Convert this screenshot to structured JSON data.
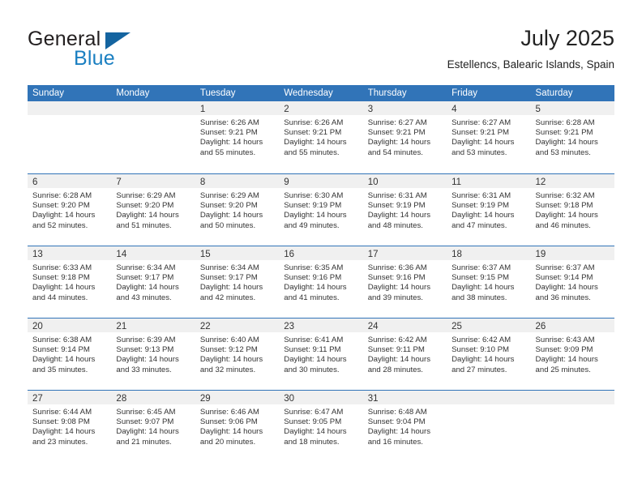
{
  "brand": {
    "name_part1": "General",
    "name_part2": "Blue",
    "triangle_icon": "triangle-icon",
    "colors": {
      "dark": "#231f20",
      "blue": "#1a7fc1",
      "triangle": "#1464a0"
    }
  },
  "header": {
    "title": "July 2025",
    "subtitle": "Estellencs, Balearic Islands, Spain"
  },
  "theme": {
    "header_blue": "#3174b8",
    "daynum_band": "#f0f0f0",
    "text": "#333333",
    "background": "#ffffff"
  },
  "weekdays": [
    "Sunday",
    "Monday",
    "Tuesday",
    "Wednesday",
    "Thursday",
    "Friday",
    "Saturday"
  ],
  "labels": {
    "sunrise": "Sunrise:",
    "sunset": "Sunset:",
    "daylight": "Daylight:"
  },
  "weeks": [
    [
      {
        "day": "",
        "sunrise": "",
        "sunset": "",
        "daylight_line1": "",
        "daylight_line2": "",
        "empty": true
      },
      {
        "day": "",
        "sunrise": "",
        "sunset": "",
        "daylight_line1": "",
        "daylight_line2": "",
        "empty": true
      },
      {
        "day": "1",
        "sunrise": "Sunrise: 6:26 AM",
        "sunset": "Sunset: 9:21 PM",
        "daylight_line1": "Daylight: 14 hours",
        "daylight_line2": "and 55 minutes.",
        "empty": false
      },
      {
        "day": "2",
        "sunrise": "Sunrise: 6:26 AM",
        "sunset": "Sunset: 9:21 PM",
        "daylight_line1": "Daylight: 14 hours",
        "daylight_line2": "and 55 minutes.",
        "empty": false
      },
      {
        "day": "3",
        "sunrise": "Sunrise: 6:27 AM",
        "sunset": "Sunset: 9:21 PM",
        "daylight_line1": "Daylight: 14 hours",
        "daylight_line2": "and 54 minutes.",
        "empty": false
      },
      {
        "day": "4",
        "sunrise": "Sunrise: 6:27 AM",
        "sunset": "Sunset: 9:21 PM",
        "daylight_line1": "Daylight: 14 hours",
        "daylight_line2": "and 53 minutes.",
        "empty": false
      },
      {
        "day": "5",
        "sunrise": "Sunrise: 6:28 AM",
        "sunset": "Sunset: 9:21 PM",
        "daylight_line1": "Daylight: 14 hours",
        "daylight_line2": "and 53 minutes.",
        "empty": false
      }
    ],
    [
      {
        "day": "6",
        "sunrise": "Sunrise: 6:28 AM",
        "sunset": "Sunset: 9:20 PM",
        "daylight_line1": "Daylight: 14 hours",
        "daylight_line2": "and 52 minutes.",
        "empty": false
      },
      {
        "day": "7",
        "sunrise": "Sunrise: 6:29 AM",
        "sunset": "Sunset: 9:20 PM",
        "daylight_line1": "Daylight: 14 hours",
        "daylight_line2": "and 51 minutes.",
        "empty": false
      },
      {
        "day": "8",
        "sunrise": "Sunrise: 6:29 AM",
        "sunset": "Sunset: 9:20 PM",
        "daylight_line1": "Daylight: 14 hours",
        "daylight_line2": "and 50 minutes.",
        "empty": false
      },
      {
        "day": "9",
        "sunrise": "Sunrise: 6:30 AM",
        "sunset": "Sunset: 9:19 PM",
        "daylight_line1": "Daylight: 14 hours",
        "daylight_line2": "and 49 minutes.",
        "empty": false
      },
      {
        "day": "10",
        "sunrise": "Sunrise: 6:31 AM",
        "sunset": "Sunset: 9:19 PM",
        "daylight_line1": "Daylight: 14 hours",
        "daylight_line2": "and 48 minutes.",
        "empty": false
      },
      {
        "day": "11",
        "sunrise": "Sunrise: 6:31 AM",
        "sunset": "Sunset: 9:19 PM",
        "daylight_line1": "Daylight: 14 hours",
        "daylight_line2": "and 47 minutes.",
        "empty": false
      },
      {
        "day": "12",
        "sunrise": "Sunrise: 6:32 AM",
        "sunset": "Sunset: 9:18 PM",
        "daylight_line1": "Daylight: 14 hours",
        "daylight_line2": "and 46 minutes.",
        "empty": false
      }
    ],
    [
      {
        "day": "13",
        "sunrise": "Sunrise: 6:33 AM",
        "sunset": "Sunset: 9:18 PM",
        "daylight_line1": "Daylight: 14 hours",
        "daylight_line2": "and 44 minutes.",
        "empty": false
      },
      {
        "day": "14",
        "sunrise": "Sunrise: 6:34 AM",
        "sunset": "Sunset: 9:17 PM",
        "daylight_line1": "Daylight: 14 hours",
        "daylight_line2": "and 43 minutes.",
        "empty": false
      },
      {
        "day": "15",
        "sunrise": "Sunrise: 6:34 AM",
        "sunset": "Sunset: 9:17 PM",
        "daylight_line1": "Daylight: 14 hours",
        "daylight_line2": "and 42 minutes.",
        "empty": false
      },
      {
        "day": "16",
        "sunrise": "Sunrise: 6:35 AM",
        "sunset": "Sunset: 9:16 PM",
        "daylight_line1": "Daylight: 14 hours",
        "daylight_line2": "and 41 minutes.",
        "empty": false
      },
      {
        "day": "17",
        "sunrise": "Sunrise: 6:36 AM",
        "sunset": "Sunset: 9:16 PM",
        "daylight_line1": "Daylight: 14 hours",
        "daylight_line2": "and 39 minutes.",
        "empty": false
      },
      {
        "day": "18",
        "sunrise": "Sunrise: 6:37 AM",
        "sunset": "Sunset: 9:15 PM",
        "daylight_line1": "Daylight: 14 hours",
        "daylight_line2": "and 38 minutes.",
        "empty": false
      },
      {
        "day": "19",
        "sunrise": "Sunrise: 6:37 AM",
        "sunset": "Sunset: 9:14 PM",
        "daylight_line1": "Daylight: 14 hours",
        "daylight_line2": "and 36 minutes.",
        "empty": false
      }
    ],
    [
      {
        "day": "20",
        "sunrise": "Sunrise: 6:38 AM",
        "sunset": "Sunset: 9:14 PM",
        "daylight_line1": "Daylight: 14 hours",
        "daylight_line2": "and 35 minutes.",
        "empty": false
      },
      {
        "day": "21",
        "sunrise": "Sunrise: 6:39 AM",
        "sunset": "Sunset: 9:13 PM",
        "daylight_line1": "Daylight: 14 hours",
        "daylight_line2": "and 33 minutes.",
        "empty": false
      },
      {
        "day": "22",
        "sunrise": "Sunrise: 6:40 AM",
        "sunset": "Sunset: 9:12 PM",
        "daylight_line1": "Daylight: 14 hours",
        "daylight_line2": "and 32 minutes.",
        "empty": false
      },
      {
        "day": "23",
        "sunrise": "Sunrise: 6:41 AM",
        "sunset": "Sunset: 9:11 PM",
        "daylight_line1": "Daylight: 14 hours",
        "daylight_line2": "and 30 minutes.",
        "empty": false
      },
      {
        "day": "24",
        "sunrise": "Sunrise: 6:42 AM",
        "sunset": "Sunset: 9:11 PM",
        "daylight_line1": "Daylight: 14 hours",
        "daylight_line2": "and 28 minutes.",
        "empty": false
      },
      {
        "day": "25",
        "sunrise": "Sunrise: 6:42 AM",
        "sunset": "Sunset: 9:10 PM",
        "daylight_line1": "Daylight: 14 hours",
        "daylight_line2": "and 27 minutes.",
        "empty": false
      },
      {
        "day": "26",
        "sunrise": "Sunrise: 6:43 AM",
        "sunset": "Sunset: 9:09 PM",
        "daylight_line1": "Daylight: 14 hours",
        "daylight_line2": "and 25 minutes.",
        "empty": false
      }
    ],
    [
      {
        "day": "27",
        "sunrise": "Sunrise: 6:44 AM",
        "sunset": "Sunset: 9:08 PM",
        "daylight_line1": "Daylight: 14 hours",
        "daylight_line2": "and 23 minutes.",
        "empty": false
      },
      {
        "day": "28",
        "sunrise": "Sunrise: 6:45 AM",
        "sunset": "Sunset: 9:07 PM",
        "daylight_line1": "Daylight: 14 hours",
        "daylight_line2": "and 21 minutes.",
        "empty": false
      },
      {
        "day": "29",
        "sunrise": "Sunrise: 6:46 AM",
        "sunset": "Sunset: 9:06 PM",
        "daylight_line1": "Daylight: 14 hours",
        "daylight_line2": "and 20 minutes.",
        "empty": false
      },
      {
        "day": "30",
        "sunrise": "Sunrise: 6:47 AM",
        "sunset": "Sunset: 9:05 PM",
        "daylight_line1": "Daylight: 14 hours",
        "daylight_line2": "and 18 minutes.",
        "empty": false
      },
      {
        "day": "31",
        "sunrise": "Sunrise: 6:48 AM",
        "sunset": "Sunset: 9:04 PM",
        "daylight_line1": "Daylight: 14 hours",
        "daylight_line2": "and 16 minutes.",
        "empty": false
      },
      {
        "day": "",
        "sunrise": "",
        "sunset": "",
        "daylight_line1": "",
        "daylight_line2": "",
        "empty": true
      },
      {
        "day": "",
        "sunrise": "",
        "sunset": "",
        "daylight_line1": "",
        "daylight_line2": "",
        "empty": true
      }
    ]
  ]
}
